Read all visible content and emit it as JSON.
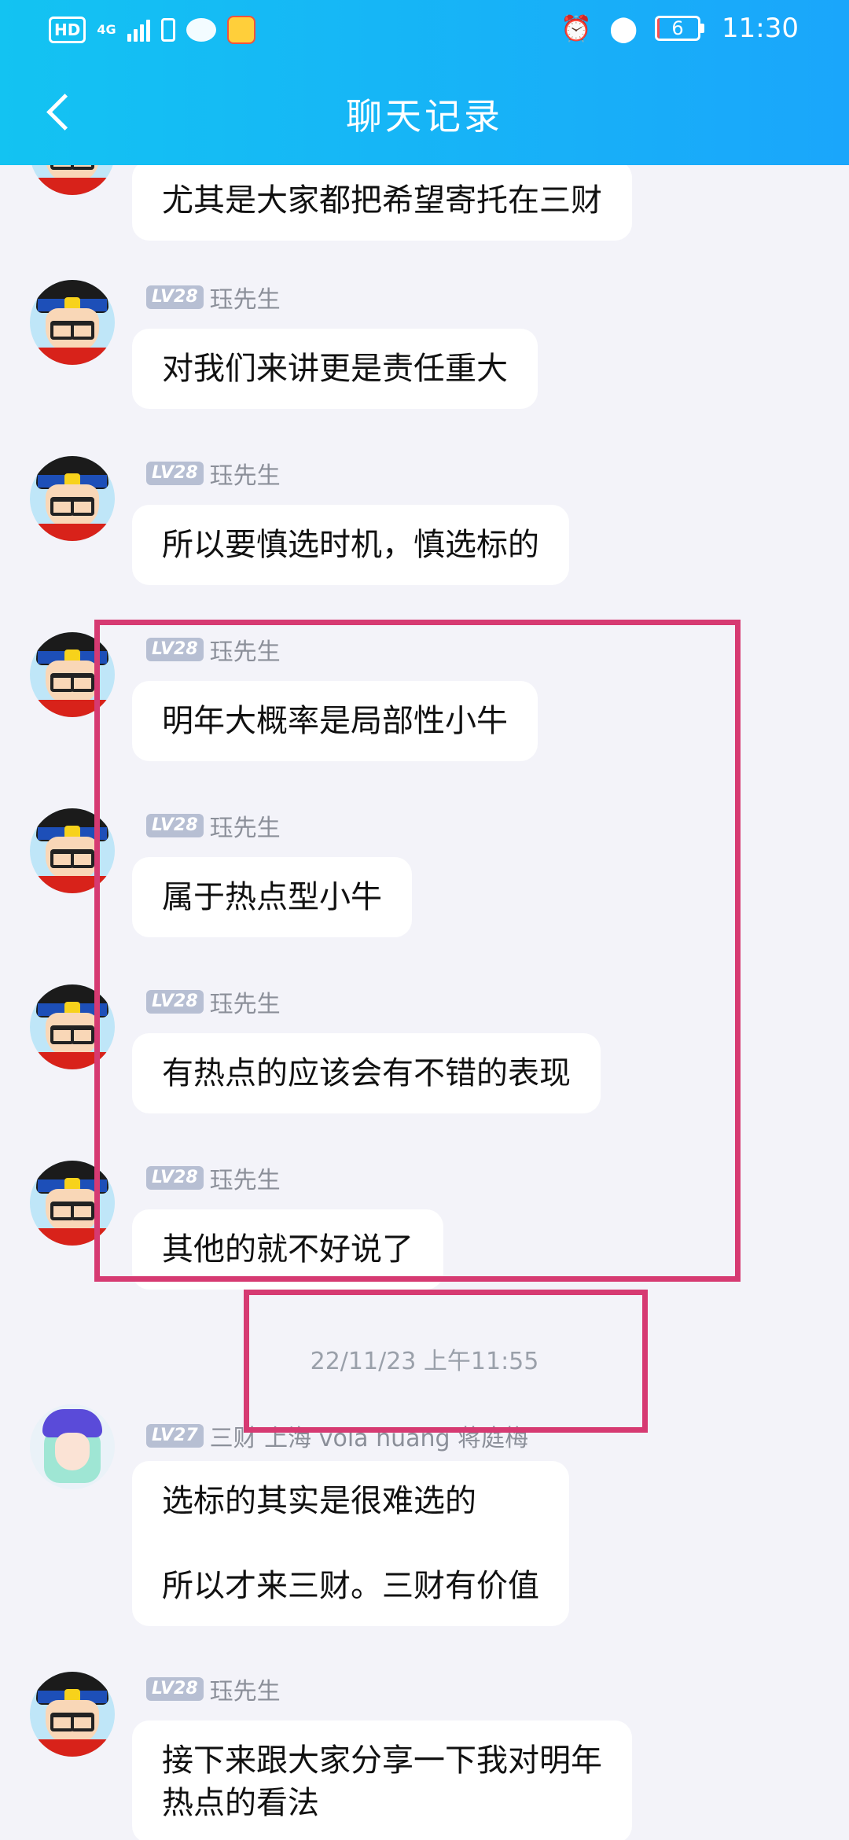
{
  "status_bar": {
    "hd": "HD",
    "network": "4G",
    "battery": "6",
    "battery_level": 0.06,
    "time": "11:30",
    "icons": [
      "signal-icon",
      "phone-icon",
      "wechat-icon",
      "app-icon",
      "alarm-icon",
      "location-icon",
      "battery-icon"
    ]
  },
  "header": {
    "title": "聊天记录",
    "back_icon": "back-arrow-icon"
  },
  "messages": [
    {
      "level": "",
      "name": "",
      "text": "尤其是大家都把希望寄托在三财"
    },
    {
      "level": "LV28",
      "name": "珏先生",
      "text": "对我们来讲更是责任重大"
    },
    {
      "level": "LV28",
      "name": "珏先生",
      "text": "所以要慎选时机，慎选标的"
    },
    {
      "level": "LV28",
      "name": "珏先生",
      "text": "明年大概率是局部性小牛"
    },
    {
      "level": "LV28",
      "name": "珏先生",
      "text": "属于热点型小牛"
    },
    {
      "level": "LV28",
      "name": "珏先生",
      "text": "有热点的应该会有不错的表现"
    },
    {
      "level": "LV28",
      "name": "珏先生",
      "text": "其他的就不好说了"
    },
    {
      "timestamp": "22/11/23 上午11:55"
    },
    {
      "level": "LV27",
      "name": "三财 上海 vola huang 蒋庭梅",
      "text": "选标的其实是很难选的\n\n所以才来三财。三财有价值"
    },
    {
      "level": "LV28",
      "name": "珏先生",
      "text": "接下来跟大家分享一下我对明年\n热点的看法"
    }
  ],
  "colors": {
    "header_start": "#13c3f2",
    "header_end": "#1aa6fb",
    "background": "#f3f3f9",
    "annotation": "#d63a72"
  }
}
